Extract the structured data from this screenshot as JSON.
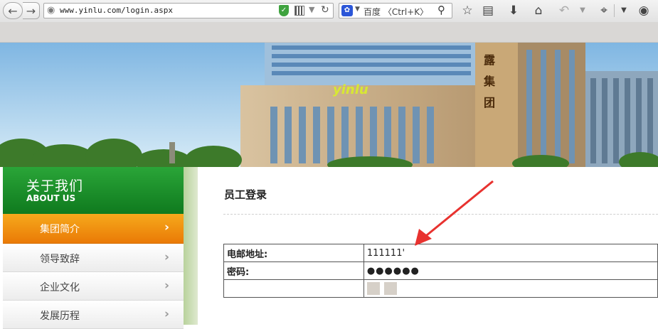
{
  "browser": {
    "url": "www.yinlu.com/login.aspx",
    "search_engine": "百度",
    "search_placeholder": "百度 〈Ctrl+K〉",
    "icons": [
      "back-icon",
      "forward-icon",
      "globe-icon",
      "shield-icon",
      "qr-icon",
      "reload-icon",
      "baidu-paw-icon",
      "search-icon",
      "star-icon",
      "bookmarks-icon",
      "download-icon",
      "home-icon",
      "undo-icon",
      "crop-icon",
      "menu-icon",
      "chat-icon"
    ]
  },
  "banner": {
    "brand_logo": "yinlu",
    "vertical_text": "露集团"
  },
  "sidebar": {
    "title_cn": "关于我们",
    "title_en": "ABOUT US",
    "items": [
      {
        "label": "集团简介",
        "active": true
      },
      {
        "label": "领导致辞",
        "active": false
      },
      {
        "label": "企业文化",
        "active": false
      },
      {
        "label": "发展历程",
        "active": false
      }
    ]
  },
  "content": {
    "title": "员工登录",
    "email_label": "电邮地址:",
    "email_value": "111111'",
    "password_label": "密码:",
    "password_value": "●●●●●●"
  },
  "colors": {
    "sidebar_header": "#1a8c2a",
    "active_item": "#f08a0e",
    "annotation_arrow": "#e8322f"
  }
}
